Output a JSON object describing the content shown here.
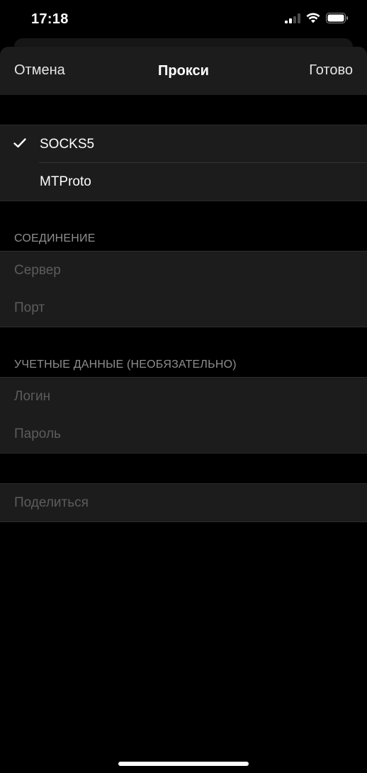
{
  "status_bar": {
    "time": "17:18"
  },
  "nav": {
    "cancel": "Отмена",
    "title": "Прокси",
    "done": "Готово"
  },
  "proxy_types": [
    {
      "label": "SOCKS5",
      "selected": true
    },
    {
      "label": "MTProto",
      "selected": false
    }
  ],
  "connection": {
    "header": "СОЕДИНЕНИЕ",
    "server_placeholder": "Сервер",
    "port_placeholder": "Порт"
  },
  "credentials": {
    "header": "УЧЕТНЫЕ ДАННЫЕ (НЕОБЯЗАТЕЛЬНО)",
    "login_placeholder": "Логин",
    "password_placeholder": "Пароль"
  },
  "share": {
    "label": "Поделиться"
  },
  "colors": {
    "background": "#000000",
    "cell": "#1c1c1c",
    "text": "#ffffff",
    "placeholder": "#5c5c5c",
    "section_header": "#8e8e8e"
  }
}
